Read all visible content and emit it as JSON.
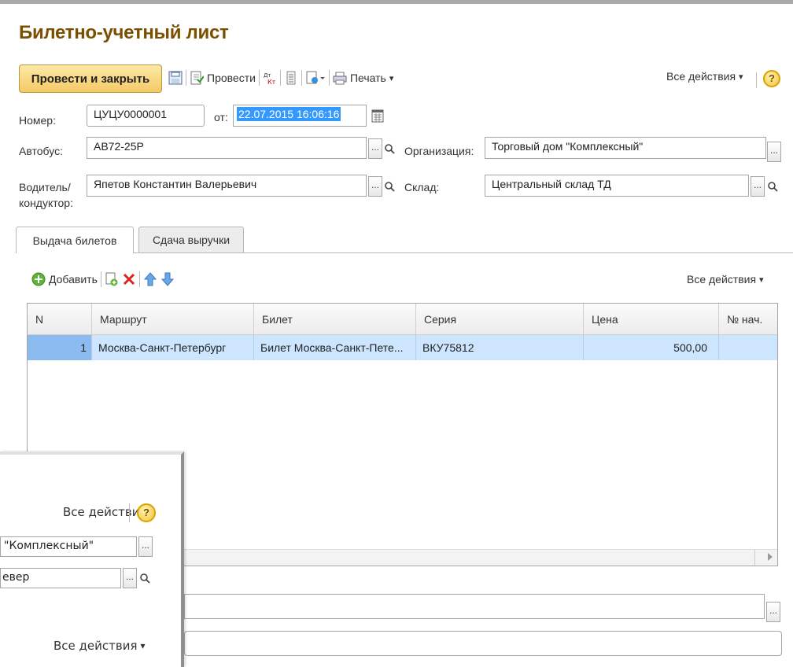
{
  "title": "Билетно-учетный лист",
  "toolbar": {
    "post_close": "Провести и закрыть",
    "post": "Провести",
    "print": "Печать",
    "all_actions": "Все действия",
    "help": "?",
    "dropdown_arrow": "▾"
  },
  "fields": {
    "number_label": "Номер:",
    "number_value": "ЦУЦУ0000001",
    "from_label": "от:",
    "date_value": "22.07.2015 16:06:16",
    "bus_label": "Автобус:",
    "bus_value": "АВ72-25Р",
    "org_label": "Организация:",
    "org_value": "Торговый дом \"Комплексный\"",
    "driver_label_1": "Водитель/",
    "driver_label_2": "кондуктор:",
    "driver_value": "Япетов Константин Валерьевич",
    "warehouse_label": "Склад:",
    "warehouse_value": "Центральный склад ТД"
  },
  "tabs": [
    "Выдача билетов",
    "Сдача выручки"
  ],
  "table_toolbar": {
    "add": "Добавить",
    "all_actions": "Все действия"
  },
  "table": {
    "headers": [
      "N",
      "Маршрут",
      "Билет",
      "Серия",
      "Цена",
      "№ нач."
    ],
    "rows": [
      [
        "1",
        "Москва-Санкт-Петербург",
        "Билет Москва-Санкт-Пете...",
        "ВКУ75812",
        "500,00",
        ""
      ]
    ]
  },
  "overlay": {
    "all_actions_1": "Все действия",
    "help": "?",
    "org_value": "\"Комплексный\"",
    "warehouse_value": "евер",
    "all_actions_2": "Все действия"
  },
  "ellipsis": "...",
  "colors": {
    "title": "#7a4f00",
    "primary_button": "#f5c964",
    "selected_row": "#cde5ff",
    "date_highlight": "#3399ff"
  }
}
